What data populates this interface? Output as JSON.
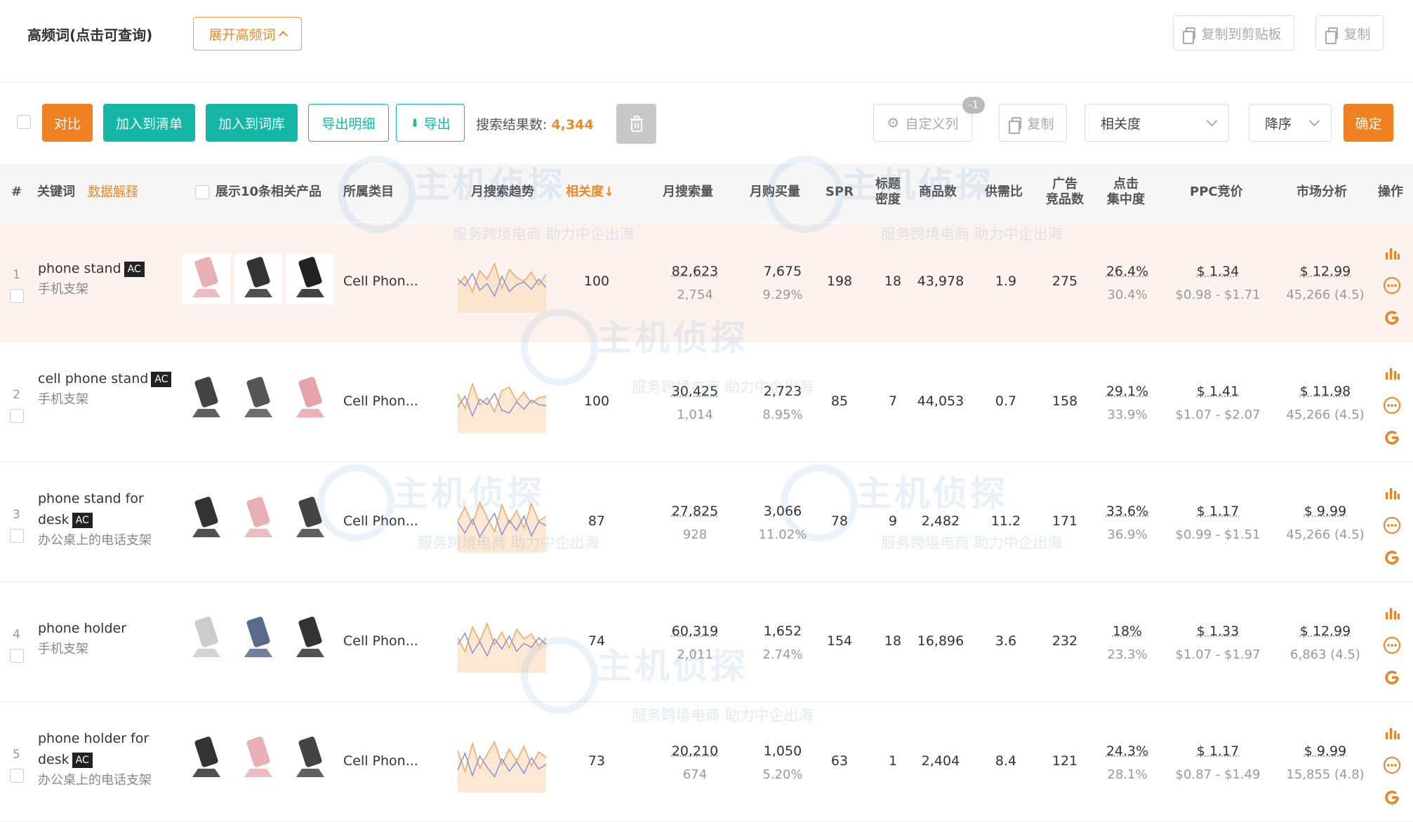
{
  "header": {
    "title": "高频词(点击可查询)",
    "expand_label": "展开高频词",
    "copy_clipboard_label": "复制到剪贴板",
    "copy_label": "复制"
  },
  "toolbar": {
    "compare": "对比",
    "add_list": "加入到清单",
    "add_lexicon": "加入到词库",
    "export_detail": "导出明细",
    "export": "导出",
    "result_label": "搜索结果数:",
    "result_count": "4,344",
    "custom_cols": "自定义列",
    "custom_badge": "-1",
    "copy": "复制",
    "sort_field": "相关度",
    "sort_order": "降序",
    "confirm": "确定"
  },
  "columns": {
    "idx": "#",
    "keyword": "关键词",
    "data_explain": "数据解释",
    "show10": "展示10条相关产品",
    "category": "所属类目",
    "trend": "月搜索趋势",
    "relevance": "相关度↓",
    "search_vol": "月搜索量",
    "purchase_vol": "月购买量",
    "spr": "SPR",
    "title_density_1": "标题",
    "title_density_2": "密度",
    "products": "商品数",
    "supply_ratio": "供需比",
    "ad_1": "广告",
    "ad_2": "竞品数",
    "click_1": "点击",
    "click_2": "集中度",
    "ppc": "PPC竞价",
    "market": "市场分析",
    "ops": "操作"
  },
  "watermark": {
    "brand": "主机侦探",
    "slogan": "服务跨境电商  助力中企出海"
  },
  "rows": [
    {
      "idx": "1",
      "keyword": "phone stand",
      "ac": "AC",
      "cn": "手机支架",
      "category": "Cell Phon...",
      "relevance": "100",
      "search": "82,623",
      "search_sub": "2,754",
      "purchase": "7,675",
      "purchase_sub": "9.29%",
      "spr": "198",
      "density": "18",
      "products": "43,978",
      "ratio": "1.9",
      "ads": "275",
      "click": "26.4%",
      "click_sub": "30.4%",
      "ppc": "$ 1.34",
      "ppc_range": "$0.98 - $1.71",
      "market": "$ 12.99",
      "market_sub": "45,266 (4.5)"
    },
    {
      "idx": "2",
      "keyword": "cell phone stand",
      "ac": "AC",
      "cn": "手机支架",
      "category": "Cell Phon...",
      "relevance": "100",
      "search": "30,425",
      "search_sub": "1,014",
      "purchase": "2,723",
      "purchase_sub": "8.95%",
      "spr": "85",
      "density": "7",
      "products": "44,053",
      "ratio": "0.7",
      "ads": "158",
      "click": "29.1%",
      "click_sub": "33.9%",
      "ppc": "$ 1.41",
      "ppc_range": "$1.07 - $2.07",
      "market": "$ 11.98",
      "market_sub": "45,266 (4.5)"
    },
    {
      "idx": "3",
      "keyword": "phone stand for desk",
      "ac": "AC",
      "cn": "办公桌上的电话支架",
      "category": "Cell Phon...",
      "relevance": "87",
      "search": "27,825",
      "search_sub": "928",
      "purchase": "3,066",
      "purchase_sub": "11.02%",
      "spr": "78",
      "density": "9",
      "products": "2,482",
      "ratio": "11.2",
      "ads": "171",
      "click": "33.6%",
      "click_sub": "36.9%",
      "ppc": "$ 1.17",
      "ppc_range": "$0.99 - $1.51",
      "market": "$ 9.99",
      "market_sub": "45,266 (4.5)"
    },
    {
      "idx": "4",
      "keyword": "phone holder",
      "ac": "",
      "cn": "手机支架",
      "category": "Cell Phon...",
      "relevance": "74",
      "search": "60,319",
      "search_sub": "2,011",
      "purchase": "1,652",
      "purchase_sub": "2.74%",
      "spr": "154",
      "density": "18",
      "products": "16,896",
      "ratio": "3.6",
      "ads": "232",
      "click": "18%",
      "click_sub": "23.3%",
      "ppc": "$ 1.33",
      "ppc_range": "$1.07 - $1.97",
      "market": "$ 12.99",
      "market_sub": "6,863 (4.5)"
    },
    {
      "idx": "5",
      "keyword": "phone holder for desk",
      "ac": "AC",
      "cn": "办公桌上的电话支架",
      "category": "Cell Phon...",
      "relevance": "73",
      "search": "20,210",
      "search_sub": "674",
      "purchase": "1,050",
      "purchase_sub": "5.20%",
      "spr": "63",
      "density": "1",
      "products": "2,404",
      "ratio": "8.4",
      "ads": "121",
      "click": "24.3%",
      "click_sub": "28.1%",
      "ppc": "$ 1.17",
      "ppc_range": "$0.87 - $1.49",
      "market": "$ 9.99",
      "market_sub": "15,855 (4.8)"
    }
  ],
  "icons": {
    "chart": "bar-chart-icon",
    "more": "more-circle-icon",
    "google": "google-icon",
    "trash": "trash-icon",
    "gear": "gear-icon",
    "download": "download-icon"
  },
  "colors": {
    "accent": "#f08123",
    "teal": "#14b7a6",
    "highlight_row": "#fdf3ee"
  }
}
